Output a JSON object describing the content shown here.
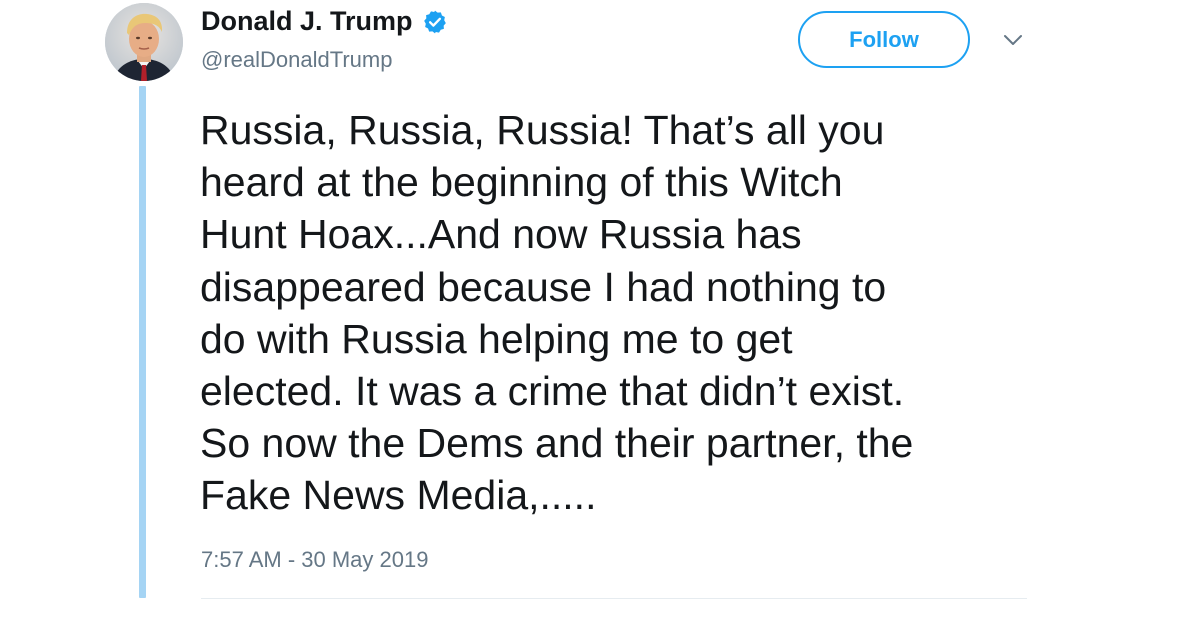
{
  "author": {
    "display_name": "Donald J. Trump",
    "handle": "@realDonaldTrump",
    "verified": true,
    "avatar_icon": "profile-photo"
  },
  "follow_button": {
    "label": "Follow",
    "color": "#1da1f2"
  },
  "menu": {
    "icon": "chevron-down-icon"
  },
  "tweet": {
    "lines": [
      "Russia, Russia, Russia! That’s all you",
      "heard at the beginning of this Witch",
      "Hunt Hoax...And now Russia has",
      "disappeared because I had nothing to",
      "do with Russia helping me to get",
      "elected. It was a crime that didn’t exist.",
      "So now the Dems and their partner, the",
      "Fake News Media,....."
    ],
    "timestamp": "7:57 AM - 30 May 2019"
  },
  "colors": {
    "accent": "#1da1f2",
    "thread_line": "#a5d4f4",
    "secondary_text": "#657786",
    "primary_text": "#14171a"
  }
}
